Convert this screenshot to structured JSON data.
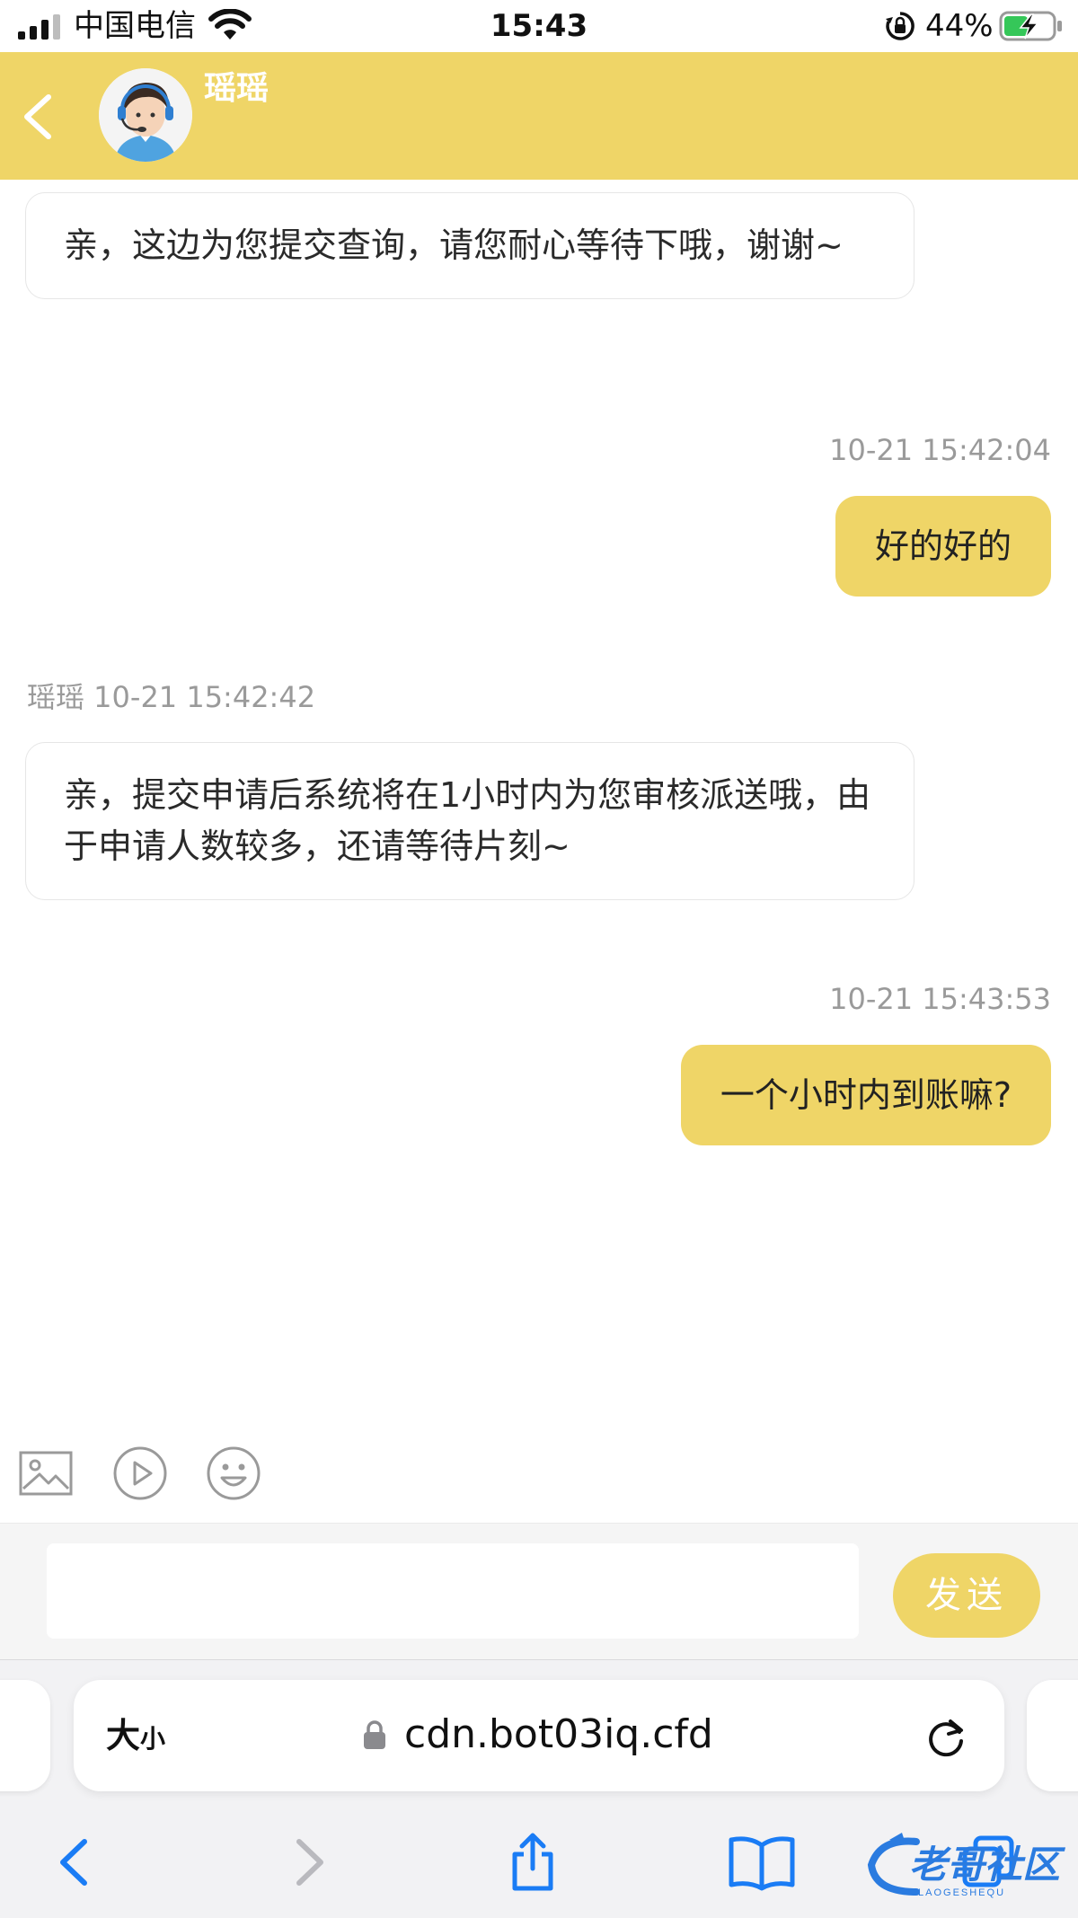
{
  "status_bar": {
    "carrier": "中国电信",
    "time": "15:43",
    "battery": "44%"
  },
  "header": {
    "agent_name": "瑶瑶"
  },
  "messages": [
    {
      "direction": "in",
      "text": "亲，这边为您提交查询，请您耐心等待下哦，谢谢~"
    },
    {
      "direction": "out",
      "timestamp": "10-21 15:42:04",
      "text": "好的好的"
    },
    {
      "direction": "in",
      "sender_timestamp": "瑶瑶 10-21 15:42:42",
      "text": "亲，提交申请后系统将在1小时内为您审核派送哦，由于申请人数较多，还请等待片刻~"
    },
    {
      "direction": "out",
      "timestamp": "10-21 15:43:53",
      "text": "一个小时内到账嘛?"
    }
  ],
  "toolbar": {
    "icons": [
      "image-icon",
      "video-play-icon",
      "emoji-icon"
    ]
  },
  "composer": {
    "input_value": "",
    "send_label": "发送"
  },
  "browser": {
    "text_size_label_big": "大",
    "text_size_label_small": "小",
    "url": "cdn.bot03iq.cfd"
  },
  "watermark": {
    "text": "老哥社区",
    "subtext": "LAOGESHEQU"
  },
  "colors": {
    "accent": "#efd567",
    "timestamp": "#9a9a9a",
    "ios_blue": "#1a7cf5"
  }
}
